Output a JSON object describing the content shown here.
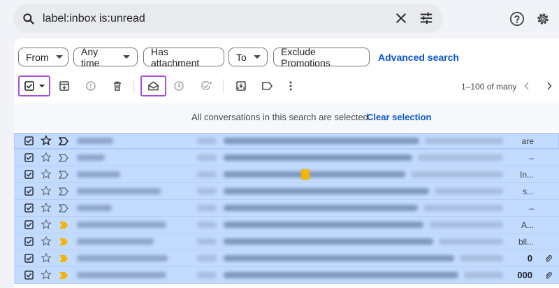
{
  "search": {
    "query": "label:inbox is:unread"
  },
  "header_icons": [
    "help-icon",
    "settings-gear-icon"
  ],
  "filters": {
    "chips": [
      {
        "label": "From",
        "dropdown": true
      },
      {
        "label": "Any time",
        "dropdown": true
      },
      {
        "label": "Has attachment",
        "dropdown": false
      },
      {
        "label": "To",
        "dropdown": true
      },
      {
        "label": "Exclude Promotions",
        "dropdown": false
      }
    ],
    "advanced": "Advanced search"
  },
  "toolbar": {
    "pager": "1–100 of many",
    "highlight_color": "#a54ed9"
  },
  "banner": {
    "text": "All conversations in this search are selected.",
    "clear": "Clear selection"
  },
  "rows": [
    {
      "tail": "are",
      "tail_bold": false,
      "attachment": false,
      "important": "dark"
    },
    {
      "tail": "–",
      "tail_bold": false,
      "attachment": false,
      "important": "outline"
    },
    {
      "tail": "In...",
      "tail_bold": false,
      "attachment": false,
      "important": "outline"
    },
    {
      "tail": "s...",
      "tail_bold": false,
      "attachment": false,
      "important": "outline"
    },
    {
      "tail": "–",
      "tail_bold": false,
      "attachment": false,
      "important": "outline"
    },
    {
      "tail": "A...",
      "tail_bold": false,
      "attachment": false,
      "important": "yellow"
    },
    {
      "tail": "bll...",
      "tail_bold": false,
      "attachment": false,
      "important": "yellow"
    },
    {
      "tail": "0",
      "tail_bold": true,
      "attachment": true,
      "important": "yellow"
    },
    {
      "tail": "000",
      "tail_bold": true,
      "attachment": true,
      "important": "yellow"
    }
  ],
  "colors": {
    "selected_row": "#c2dbff",
    "accent": "#0b57d0",
    "important_yellow": "#f4b400"
  }
}
